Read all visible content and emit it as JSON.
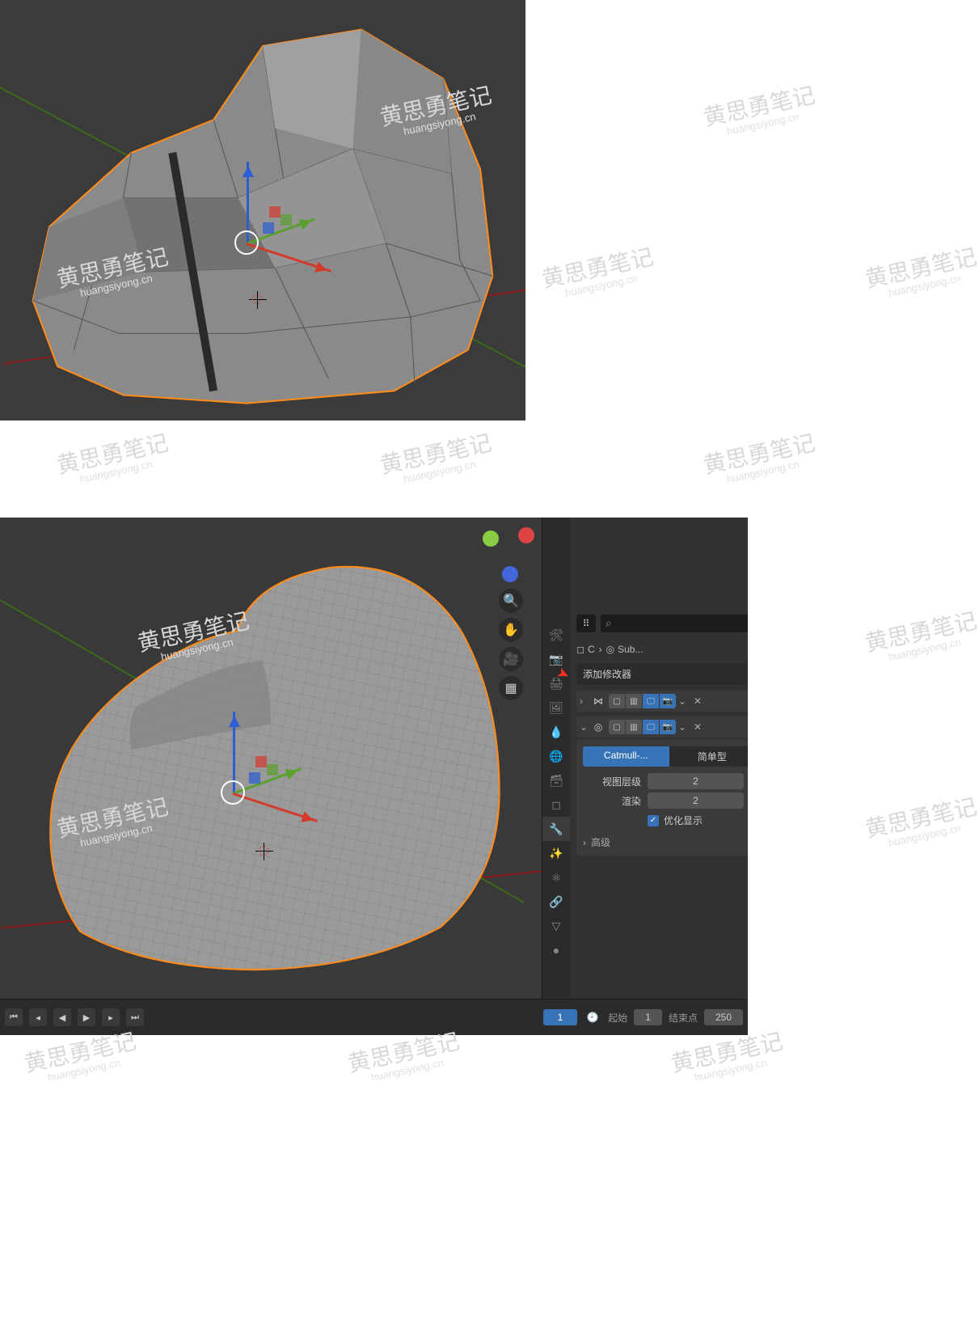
{
  "watermark": {
    "text": "黄思勇笔记",
    "sub": "huangsiyong.cn"
  },
  "breadcrumb": {
    "obj": "C",
    "mod": "Sub..."
  },
  "add_modifier_label": "添加修改器",
  "modifier_subdiv": {
    "catmull_label": "Catmull-...",
    "simple_label": "简单型",
    "viewport_label": "视图层级",
    "viewport_value": "2",
    "render_label": "渲染",
    "render_value": "2",
    "optimal_label": "优化显示",
    "advanced_label": "高级"
  },
  "timeline": {
    "current": "1",
    "start_label": "起始",
    "start_value": "1",
    "end_label": "结束点",
    "end_value": "250"
  },
  "search_placeholder": ""
}
